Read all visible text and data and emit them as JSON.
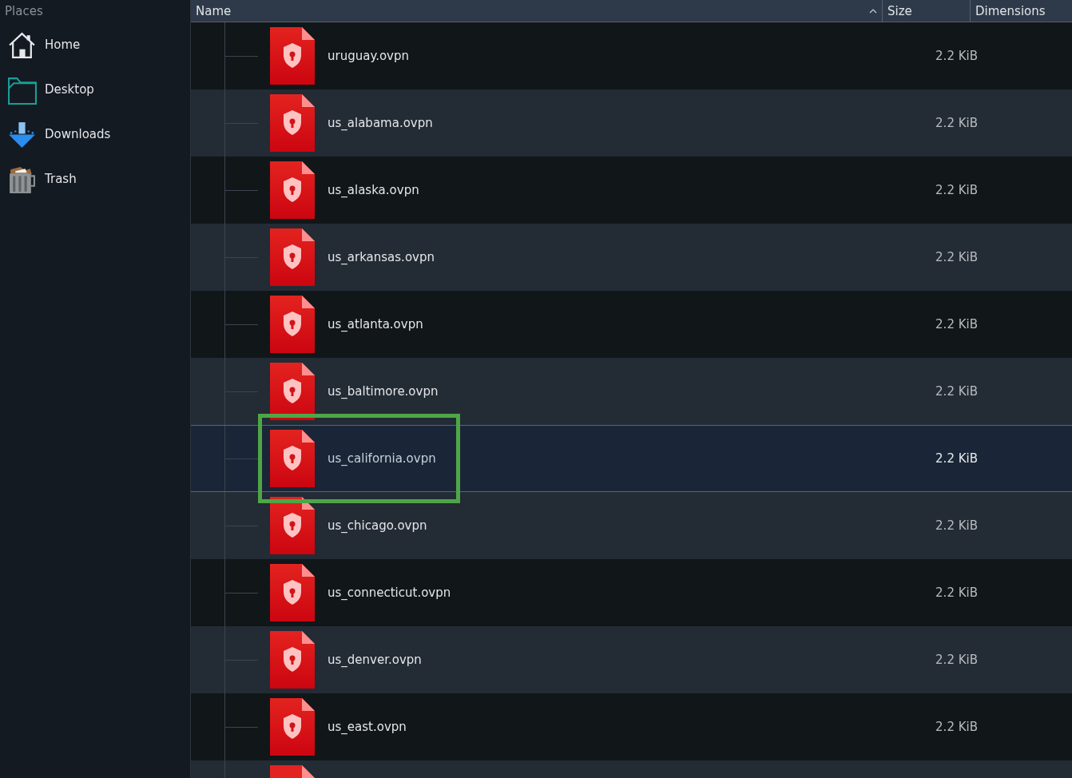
{
  "sidebar": {
    "title": "Places",
    "items": [
      {
        "label": "Home",
        "kind": "home"
      },
      {
        "label": "Desktop",
        "kind": "desktop"
      },
      {
        "label": "Downloads",
        "kind": "downloads"
      },
      {
        "label": "Trash",
        "kind": "trash"
      }
    ]
  },
  "table": {
    "columns": [
      {
        "label": "Name",
        "sorted": true
      },
      {
        "label": "Size",
        "sorted": false
      },
      {
        "label": "Dimensions",
        "sorted": false
      }
    ],
    "rows": [
      {
        "name": "uruguay.ovpn",
        "size": "2.2 KiB",
        "selected": false,
        "highlighted": false
      },
      {
        "name": "us_alabama.ovpn",
        "size": "2.2 KiB",
        "selected": false,
        "highlighted": false
      },
      {
        "name": "us_alaska.ovpn",
        "size": "2.2 KiB",
        "selected": false,
        "highlighted": false
      },
      {
        "name": "us_arkansas.ovpn",
        "size": "2.2 KiB",
        "selected": false,
        "highlighted": false
      },
      {
        "name": "us_atlanta.ovpn",
        "size": "2.2 KiB",
        "selected": false,
        "highlighted": false
      },
      {
        "name": "us_baltimore.ovpn",
        "size": "2.2 KiB",
        "selected": false,
        "highlighted": false
      },
      {
        "name": "us_california.ovpn",
        "size": "2.2 KiB",
        "selected": true,
        "highlighted": true
      },
      {
        "name": "us_chicago.ovpn",
        "size": "2.2 KiB",
        "selected": false,
        "highlighted": false
      },
      {
        "name": "us_connecticut.ovpn",
        "size": "2.2 KiB",
        "selected": false,
        "highlighted": false
      },
      {
        "name": "us_denver.ovpn",
        "size": "2.2 KiB",
        "selected": false,
        "highlighted": false
      },
      {
        "name": "us_east.ovpn",
        "size": "2.2 KiB",
        "selected": false,
        "highlighted": false
      }
    ]
  }
}
